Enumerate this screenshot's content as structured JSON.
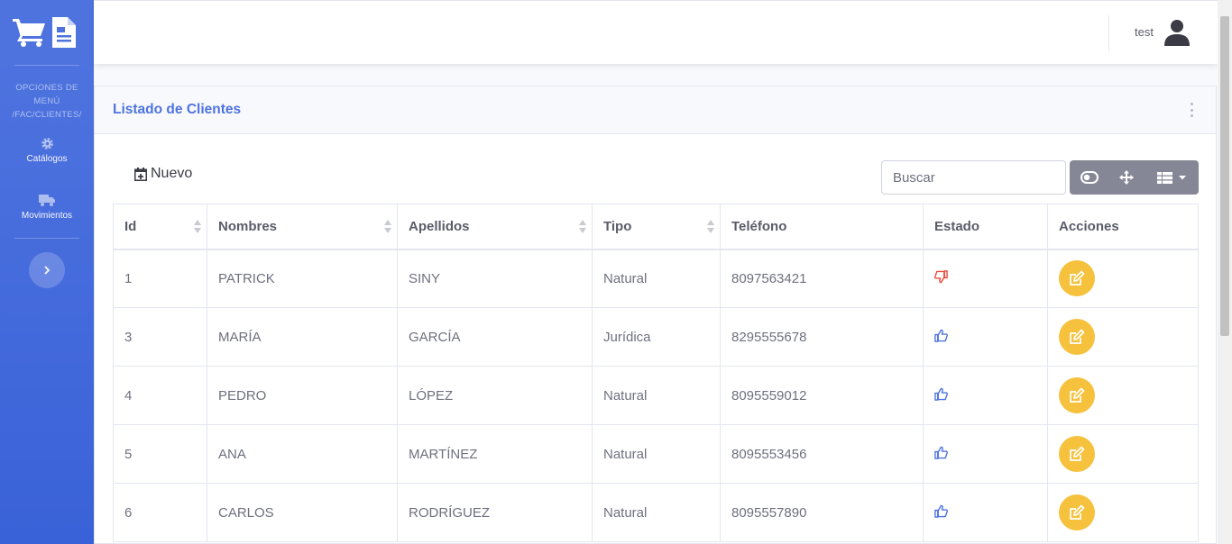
{
  "sidebar": {
    "heading_line1": "OPCIONES DE",
    "heading_line2": "MENÚ",
    "heading_line3": "/FAC/CLIENTES/",
    "items": [
      {
        "label": "Catálogos",
        "icon": "cog-icon"
      },
      {
        "label": "Movimientos",
        "icon": "truck-icon"
      }
    ]
  },
  "topbar": {
    "user_name": "test"
  },
  "card": {
    "title": "Listado de Clientes"
  },
  "toolbar": {
    "new_label": "Nuevo",
    "search_placeholder": "Buscar"
  },
  "table": {
    "columns": [
      "Id",
      "Nombres",
      "Apellidos",
      "Tipo",
      "Teléfono",
      "Estado",
      "Acciones"
    ],
    "rows": [
      {
        "id": "1",
        "nombres": "PATRICK",
        "apellidos": "SINY",
        "tipo": "Natural",
        "telefono": "8097563421",
        "estado": "inactive"
      },
      {
        "id": "3",
        "nombres": "MARÍA",
        "apellidos": "GARCÍA",
        "tipo": "Jurídica",
        "telefono": "8295555678",
        "estado": "active"
      },
      {
        "id": "4",
        "nombres": "PEDRO",
        "apellidos": "LÓPEZ",
        "tipo": "Natural",
        "telefono": "8095559012",
        "estado": "active"
      },
      {
        "id": "5",
        "nombres": "ANA",
        "apellidos": "MARTÍNEZ",
        "tipo": "Natural",
        "telefono": "8095553456",
        "estado": "active"
      },
      {
        "id": "6",
        "nombres": "CARLOS",
        "apellidos": "RODRÍGUEZ",
        "tipo": "Natural",
        "telefono": "8095557890",
        "estado": "active"
      }
    ]
  },
  "colors": {
    "primary": "#4e73df",
    "warning": "#f6c23e",
    "danger": "#e74a3b",
    "secondary": "#858796"
  }
}
